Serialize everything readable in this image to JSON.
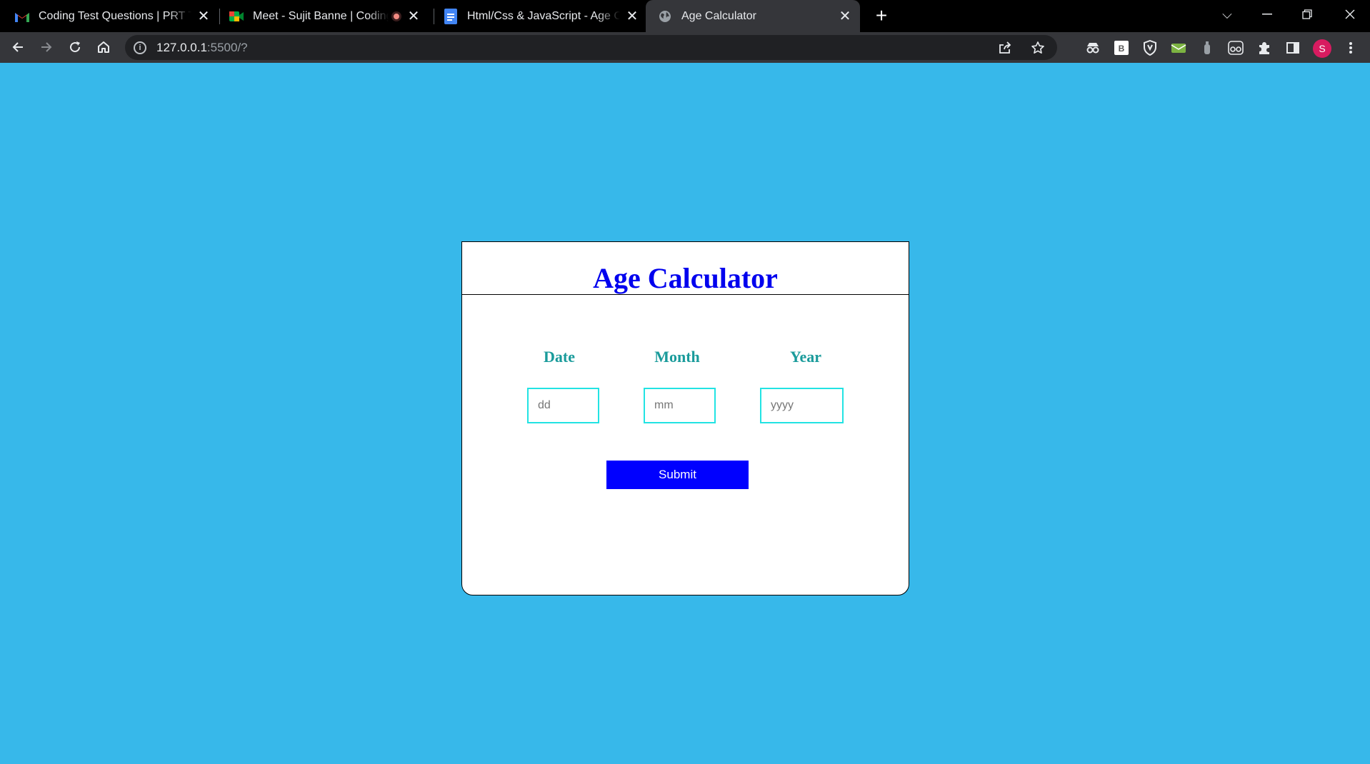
{
  "browser": {
    "tabs": [
      {
        "title": "Coding Test Questions | PRT Test",
        "icon": "gmail-icon"
      },
      {
        "title": "Meet - Sujit Banne | Coding Test",
        "icon": "google-meet-icon"
      },
      {
        "title": "Html/Css & JavaScript - Age Calculator",
        "icon": "google-docs-icon"
      },
      {
        "title": "Age Calculator",
        "icon": "globe-icon"
      }
    ],
    "url_host": "127.0.0.1",
    "url_path": ":5500/?",
    "profile_initial": "S",
    "extensions": [
      "spy-icon",
      "bootstrap-b-icon",
      "shield-icon",
      "green-mail-icon",
      "bottle-icon",
      "glasses-icon",
      "puzzle-icon",
      "side-panel-icon"
    ]
  },
  "page": {
    "title": "Age Calculator",
    "labels": {
      "date": "Date",
      "month": "Month",
      "year": "Year"
    },
    "placeholders": {
      "date": "dd",
      "month": "mm",
      "year": "yyyy"
    },
    "submit_label": "Submit"
  },
  "colors": {
    "background": "#37b8ea",
    "title": "#0000ee",
    "label": "#1a9b9b",
    "input_border": "#22e3e3",
    "button": "#0000ff"
  }
}
